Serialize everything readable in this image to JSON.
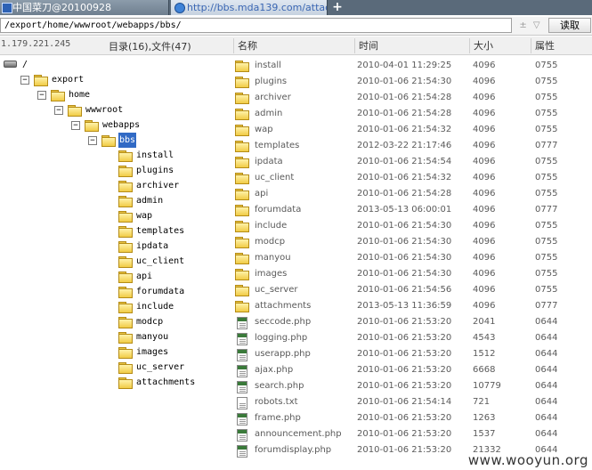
{
  "tabs": [
    {
      "label": "中国菜刀@20100928",
      "icon": "app-window-icon"
    },
    {
      "label": "http://bbs.mda139.com/attac...",
      "icon": "globe-icon"
    }
  ],
  "new_tab_label": "+",
  "pathbar": {
    "path": "/export/home/wwwroot/webapps/bbs/",
    "nav_glyph": "± ▽",
    "read_button": "读取"
  },
  "header": {
    "ip": "1.179.221.245",
    "count": "目录(16),文件(47)",
    "columns": {
      "name": "名称",
      "time": "时间",
      "size": "大小",
      "perm": "属性"
    }
  },
  "tree": [
    {
      "label": "/",
      "level": 0,
      "type": "drive"
    },
    {
      "label": "export",
      "level": 1,
      "type": "folder",
      "expanded": true
    },
    {
      "label": "home",
      "level": 2,
      "type": "folder",
      "expanded": true
    },
    {
      "label": "wwwroot",
      "level": 3,
      "type": "folder",
      "expanded": true
    },
    {
      "label": "webapps",
      "level": 4,
      "type": "folder",
      "expanded": true
    },
    {
      "label": "bbs",
      "level": 5,
      "type": "folder",
      "expanded": true,
      "selected": true
    },
    {
      "label": "install",
      "level": 6,
      "type": "folder"
    },
    {
      "label": "plugins",
      "level": 6,
      "type": "folder"
    },
    {
      "label": "archiver",
      "level": 6,
      "type": "folder"
    },
    {
      "label": "admin",
      "level": 6,
      "type": "folder"
    },
    {
      "label": "wap",
      "level": 6,
      "type": "folder"
    },
    {
      "label": "templates",
      "level": 6,
      "type": "folder"
    },
    {
      "label": "ipdata",
      "level": 6,
      "type": "folder"
    },
    {
      "label": "uc_client",
      "level": 6,
      "type": "folder"
    },
    {
      "label": "api",
      "level": 6,
      "type": "folder"
    },
    {
      "label": "forumdata",
      "level": 6,
      "type": "folder"
    },
    {
      "label": "include",
      "level": 6,
      "type": "folder"
    },
    {
      "label": "modcp",
      "level": 6,
      "type": "folder"
    },
    {
      "label": "manyou",
      "level": 6,
      "type": "folder"
    },
    {
      "label": "images",
      "level": 6,
      "type": "folder"
    },
    {
      "label": "uc_server",
      "level": 6,
      "type": "folder"
    },
    {
      "label": "attachments",
      "level": 6,
      "type": "folder"
    }
  ],
  "files": [
    {
      "name": "install",
      "time": "2010-04-01 11:29:25",
      "size": "4096",
      "perm": "0755",
      "type": "folder"
    },
    {
      "name": "plugins",
      "time": "2010-01-06 21:54:30",
      "size": "4096",
      "perm": "0755",
      "type": "folder"
    },
    {
      "name": "archiver",
      "time": "2010-01-06 21:54:28",
      "size": "4096",
      "perm": "0755",
      "type": "folder"
    },
    {
      "name": "admin",
      "time": "2010-01-06 21:54:28",
      "size": "4096",
      "perm": "0755",
      "type": "folder"
    },
    {
      "name": "wap",
      "time": "2010-01-06 21:54:32",
      "size": "4096",
      "perm": "0755",
      "type": "folder"
    },
    {
      "name": "templates",
      "time": "2012-03-22 21:17:46",
      "size": "4096",
      "perm": "0777",
      "type": "folder"
    },
    {
      "name": "ipdata",
      "time": "2010-01-06 21:54:54",
      "size": "4096",
      "perm": "0755",
      "type": "folder"
    },
    {
      "name": "uc_client",
      "time": "2010-01-06 21:54:32",
      "size": "4096",
      "perm": "0755",
      "type": "folder"
    },
    {
      "name": "api",
      "time": "2010-01-06 21:54:28",
      "size": "4096",
      "perm": "0755",
      "type": "folder"
    },
    {
      "name": "forumdata",
      "time": "2013-05-13 06:00:01",
      "size": "4096",
      "perm": "0777",
      "type": "folder"
    },
    {
      "name": "include",
      "time": "2010-01-06 21:54:30",
      "size": "4096",
      "perm": "0755",
      "type": "folder"
    },
    {
      "name": "modcp",
      "time": "2010-01-06 21:54:30",
      "size": "4096",
      "perm": "0755",
      "type": "folder"
    },
    {
      "name": "manyou",
      "time": "2010-01-06 21:54:30",
      "size": "4096",
      "perm": "0755",
      "type": "folder"
    },
    {
      "name": "images",
      "time": "2010-01-06 21:54:30",
      "size": "4096",
      "perm": "0755",
      "type": "folder"
    },
    {
      "name": "uc_server",
      "time": "2010-01-06 21:54:56",
      "size": "4096",
      "perm": "0755",
      "type": "folder"
    },
    {
      "name": "attachments",
      "time": "2013-05-13 11:36:59",
      "size": "4096",
      "perm": "0777",
      "type": "folder"
    },
    {
      "name": "seccode.php",
      "time": "2010-01-06 21:53:20",
      "size": "2041",
      "perm": "0644",
      "type": "php"
    },
    {
      "name": "logging.php",
      "time": "2010-01-06 21:53:20",
      "size": "4543",
      "perm": "0644",
      "type": "php"
    },
    {
      "name": "userapp.php",
      "time": "2010-01-06 21:53:20",
      "size": "1512",
      "perm": "0644",
      "type": "php"
    },
    {
      "name": "ajax.php",
      "time": "2010-01-06 21:53:20",
      "size": "6668",
      "perm": "0644",
      "type": "php"
    },
    {
      "name": "search.php",
      "time": "2010-01-06 21:53:20",
      "size": "10779",
      "perm": "0644",
      "type": "php"
    },
    {
      "name": "robots.txt",
      "time": "2010-01-06 21:54:14",
      "size": "721",
      "perm": "0644",
      "type": "txt"
    },
    {
      "name": "frame.php",
      "time": "2010-01-06 21:53:20",
      "size": "1263",
      "perm": "0644",
      "type": "php"
    },
    {
      "name": "announcement.php",
      "time": "2010-01-06 21:53:20",
      "size": "1537",
      "perm": "0644",
      "type": "php"
    },
    {
      "name": "forumdisplay.php",
      "time": "2010-01-06 21:53:20",
      "size": "21332",
      "perm": "0644",
      "type": "php"
    }
  ],
  "watermark": "www.wooyun.org",
  "colors": {
    "selection": "#316ac5",
    "folder": "#f1cc45",
    "tabbar": "#5a6a7a",
    "link": "#3a66b3"
  }
}
